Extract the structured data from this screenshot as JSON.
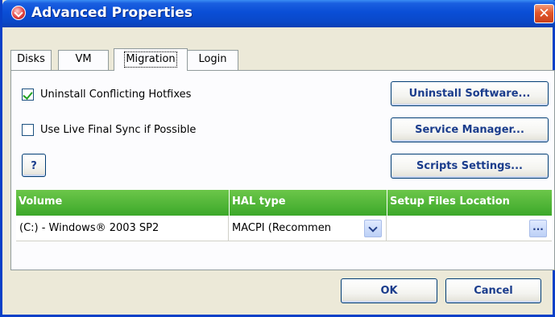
{
  "window": {
    "title": "Advanced Properties",
    "close_glyph": "✕"
  },
  "tabs": [
    {
      "label": "Disks",
      "active": false
    },
    {
      "label": "VM",
      "active": false
    },
    {
      "label": "Migration",
      "active": true
    },
    {
      "label": "Login",
      "active": false
    }
  ],
  "options": {
    "uninstall_hotfixes": {
      "label": "Uninstall Conflicting Hotfixes",
      "checked": true
    },
    "live_final_sync": {
      "label": "Use Live Final Sync if Possible",
      "checked": false
    }
  },
  "buttons": {
    "help": "?",
    "uninstall_software": "Uninstall Software...",
    "service_manager": "Service Manager...",
    "scripts_settings": "Scripts Settings...",
    "ok": "OK",
    "cancel": "Cancel"
  },
  "grid": {
    "columns": [
      "Volume",
      "HAL type",
      "Setup Files Location"
    ],
    "rows": [
      {
        "volume": "(C:) - Windows® 2003 SP2",
        "hal_type": "MACPI (Recommen",
        "setup_files_location": "",
        "browse": "..."
      }
    ]
  },
  "icons": {
    "app": "app-check-icon",
    "close": "close-icon",
    "dropdown": "chevron-down-icon"
  },
  "colors": {
    "titlebar": "#0a4ed6",
    "grid_header": "#3ca82a",
    "button_text": "#1a3c8c",
    "close": "#e2562a"
  }
}
